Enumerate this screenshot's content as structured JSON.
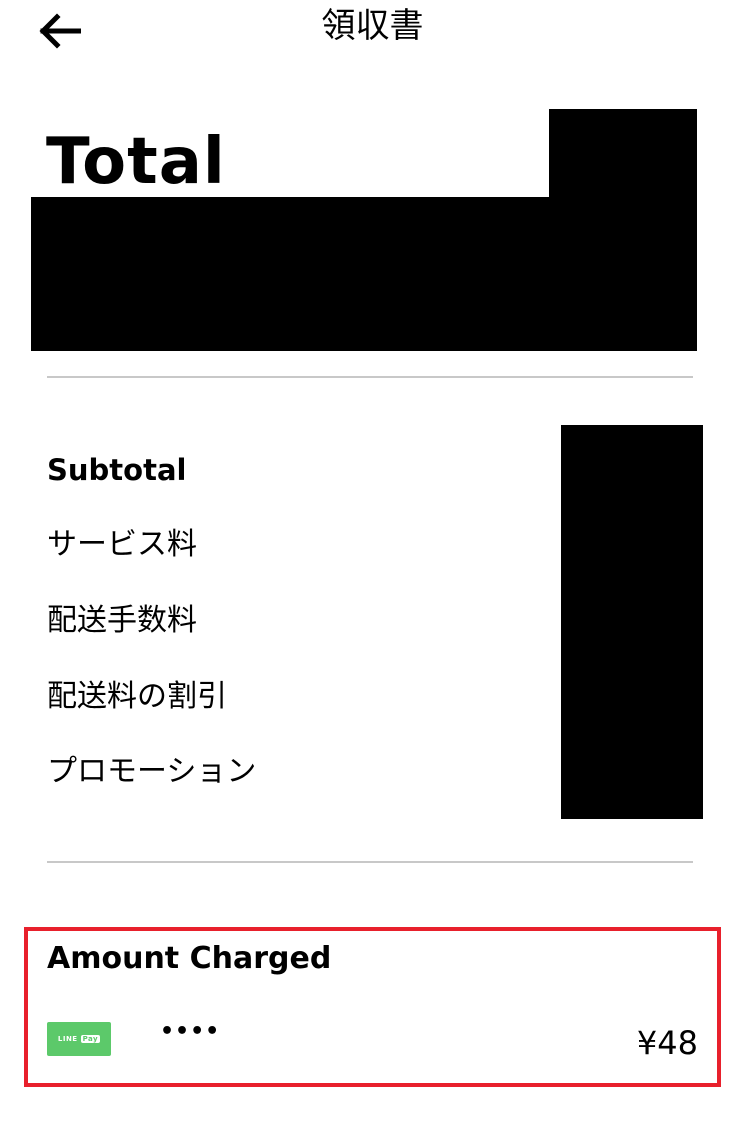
{
  "header": {
    "title": "領収書",
    "back_icon": "arrow-left-icon"
  },
  "total": {
    "label": "Total"
  },
  "breakdown": {
    "items": [
      {
        "label": "Subtotal"
      },
      {
        "label": "サービス料"
      },
      {
        "label": "配送手数料"
      },
      {
        "label": "配送料の割引"
      },
      {
        "label": "プロモーション"
      }
    ]
  },
  "charged": {
    "title": "Amount Charged",
    "payment_method": {
      "badge_text": "LINE",
      "badge_pill": "Pay",
      "masked": "••••"
    },
    "amount": "¥48"
  },
  "colors": {
    "highlight_border": "#e8202c",
    "line_pay_green": "#5cc96a",
    "divider": "#c8c8c8"
  }
}
